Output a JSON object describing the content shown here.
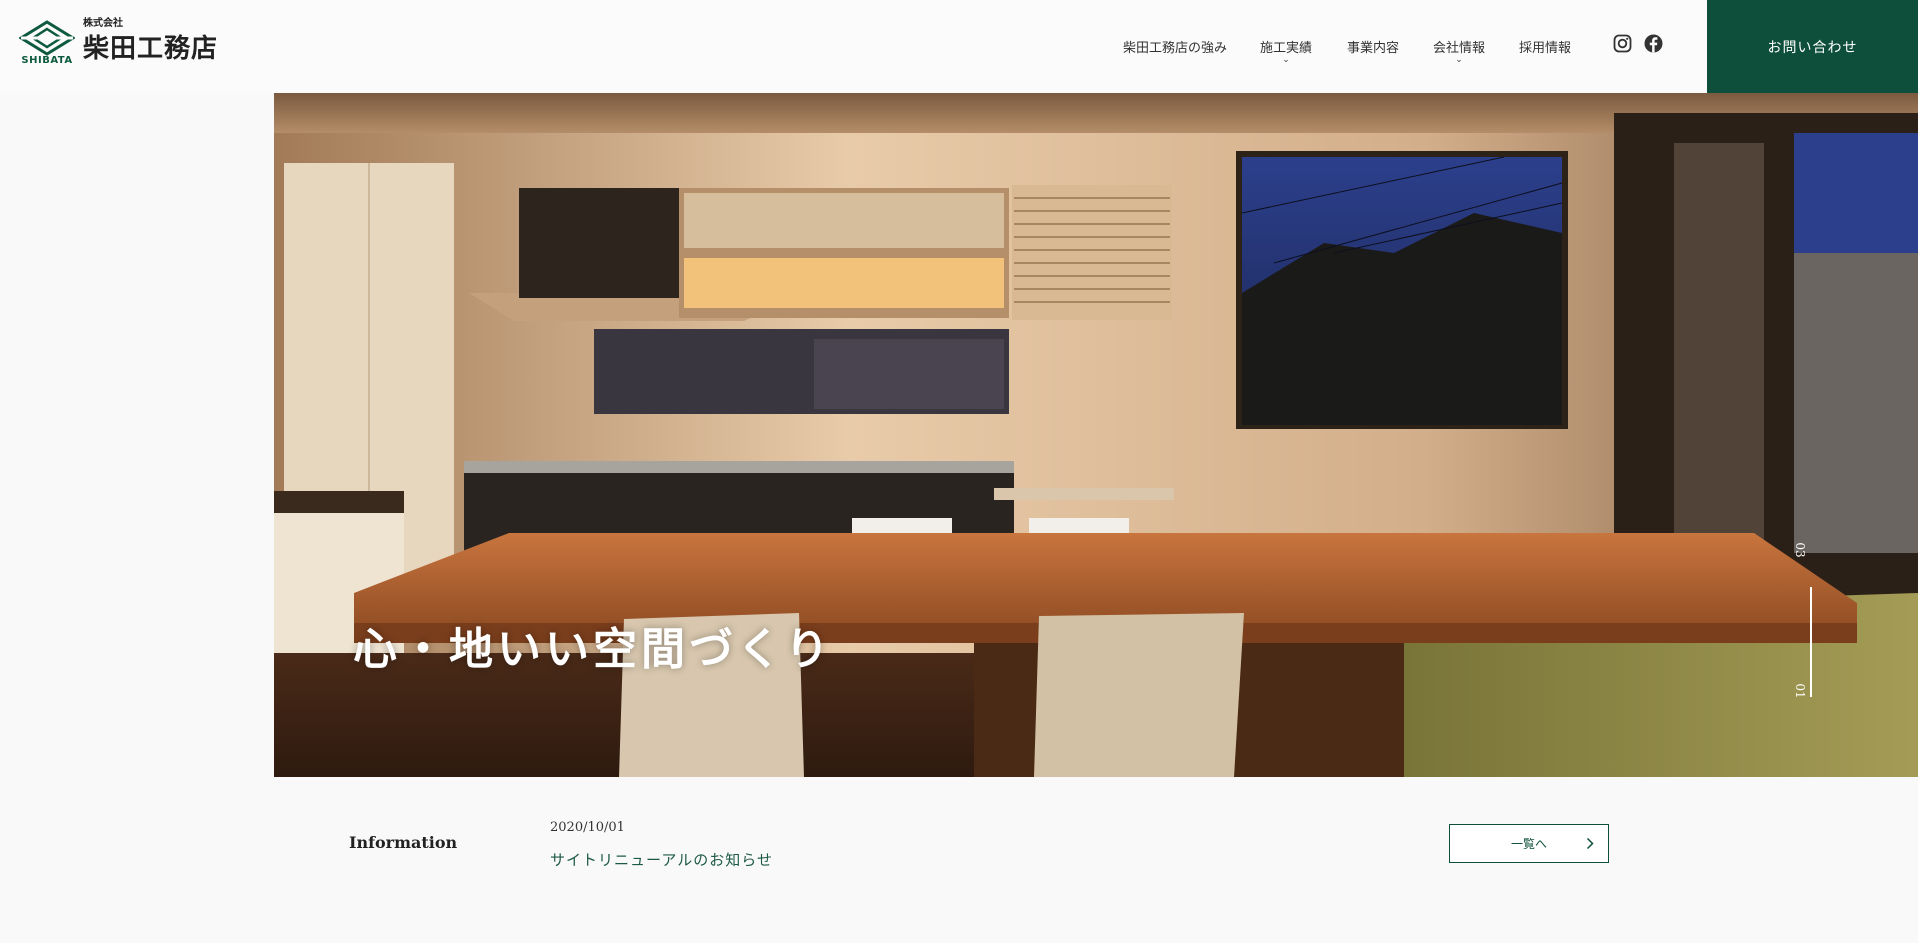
{
  "header": {
    "logo": {
      "sub": "株式会社",
      "main": "柴田工務店",
      "en": "SHIBATA"
    },
    "nav": [
      {
        "label": "柴田工務店の強み",
        "has_dropdown": false
      },
      {
        "label": "施工実績",
        "has_dropdown": true
      },
      {
        "label": "事業内容",
        "has_dropdown": false
      },
      {
        "label": "会社情報",
        "has_dropdown": true
      },
      {
        "label": "採用情報",
        "has_dropdown": false
      }
    ],
    "dropdown_glyph": "⌄",
    "social": [
      {
        "icon": "instagram-icon"
      },
      {
        "icon": "facebook-icon"
      }
    ],
    "contact_label": "お問い合わせ"
  },
  "hero": {
    "catch": "心・地いい空間づくり",
    "slide_total": "03",
    "slide_current": "01"
  },
  "information": {
    "label": "Information",
    "items": [
      {
        "date": "2020/10/01",
        "title": "サイトリニューアルのお知らせ"
      }
    ],
    "list_button": "一覧へ"
  },
  "colors": {
    "brand": "#0d4f3a",
    "text": "#333333",
    "link": "#1d5a45"
  }
}
